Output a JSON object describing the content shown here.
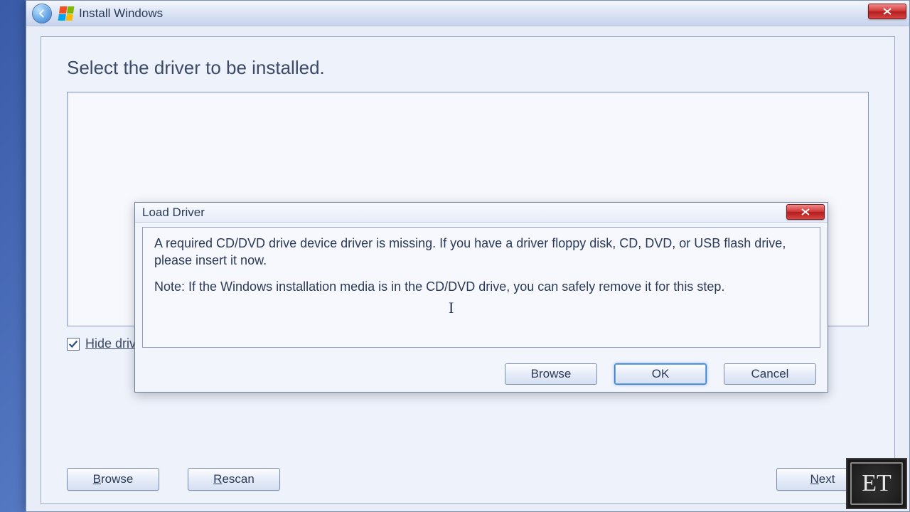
{
  "window": {
    "title": "Install Windows",
    "heading": "Select the driver to be installed.",
    "hide_label": "Hide drivers that are not compatible with hardware on this computer.",
    "buttons": {
      "browse": "Browse",
      "rescan": "Rescan",
      "next": "Next"
    }
  },
  "dialog": {
    "title": "Load Driver",
    "msg1": "A required CD/DVD drive device driver is missing. If you have a driver floppy disk, CD, DVD, or USB flash drive, please insert it now.",
    "msg2": "Note: If the Windows installation media is in the CD/DVD drive, you can safely remove it for this step.",
    "buttons": {
      "browse": "Browse",
      "ok": "OK",
      "cancel": "Cancel"
    }
  },
  "watermark": "ET"
}
